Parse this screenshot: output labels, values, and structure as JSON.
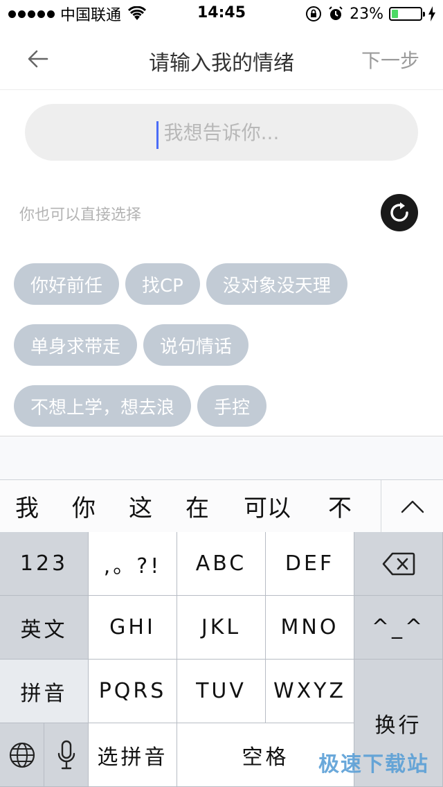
{
  "status_bar": {
    "carrier": "中国联通",
    "time": "14:45",
    "battery_percent": "23%",
    "battery_level": 0.23,
    "battery_color": "#4cd964"
  },
  "nav": {
    "back_icon": "arrow-left-icon",
    "title": "请输入我的情绪",
    "next_label": "下一步"
  },
  "input": {
    "placeholder": "我想告诉你...",
    "value": ""
  },
  "hint": "你也可以直接选择",
  "refresh_icon": "refresh-icon",
  "tags": [
    [
      "你好前任",
      "找CP",
      "没对象没天理"
    ],
    [
      "单身求带走",
      "说句情话"
    ],
    [
      "不想上学，想去浪",
      "手控"
    ]
  ],
  "tag_color": "#c2cbd5",
  "candidates": [
    "我",
    "你",
    "这",
    "在",
    "可以",
    "不"
  ],
  "keyboard": {
    "row1": [
      "123",
      ",。?!",
      "ABC",
      "DEF"
    ],
    "row2": [
      "英文",
      "GHI",
      "JKL",
      "MNO",
      "^_^"
    ],
    "row3": [
      "拼音",
      "PQRS",
      "TUV",
      "WXYZ"
    ],
    "row4": [
      "选拼音",
      "空格"
    ],
    "enter": "换行"
  },
  "watermark": "极速下载站"
}
